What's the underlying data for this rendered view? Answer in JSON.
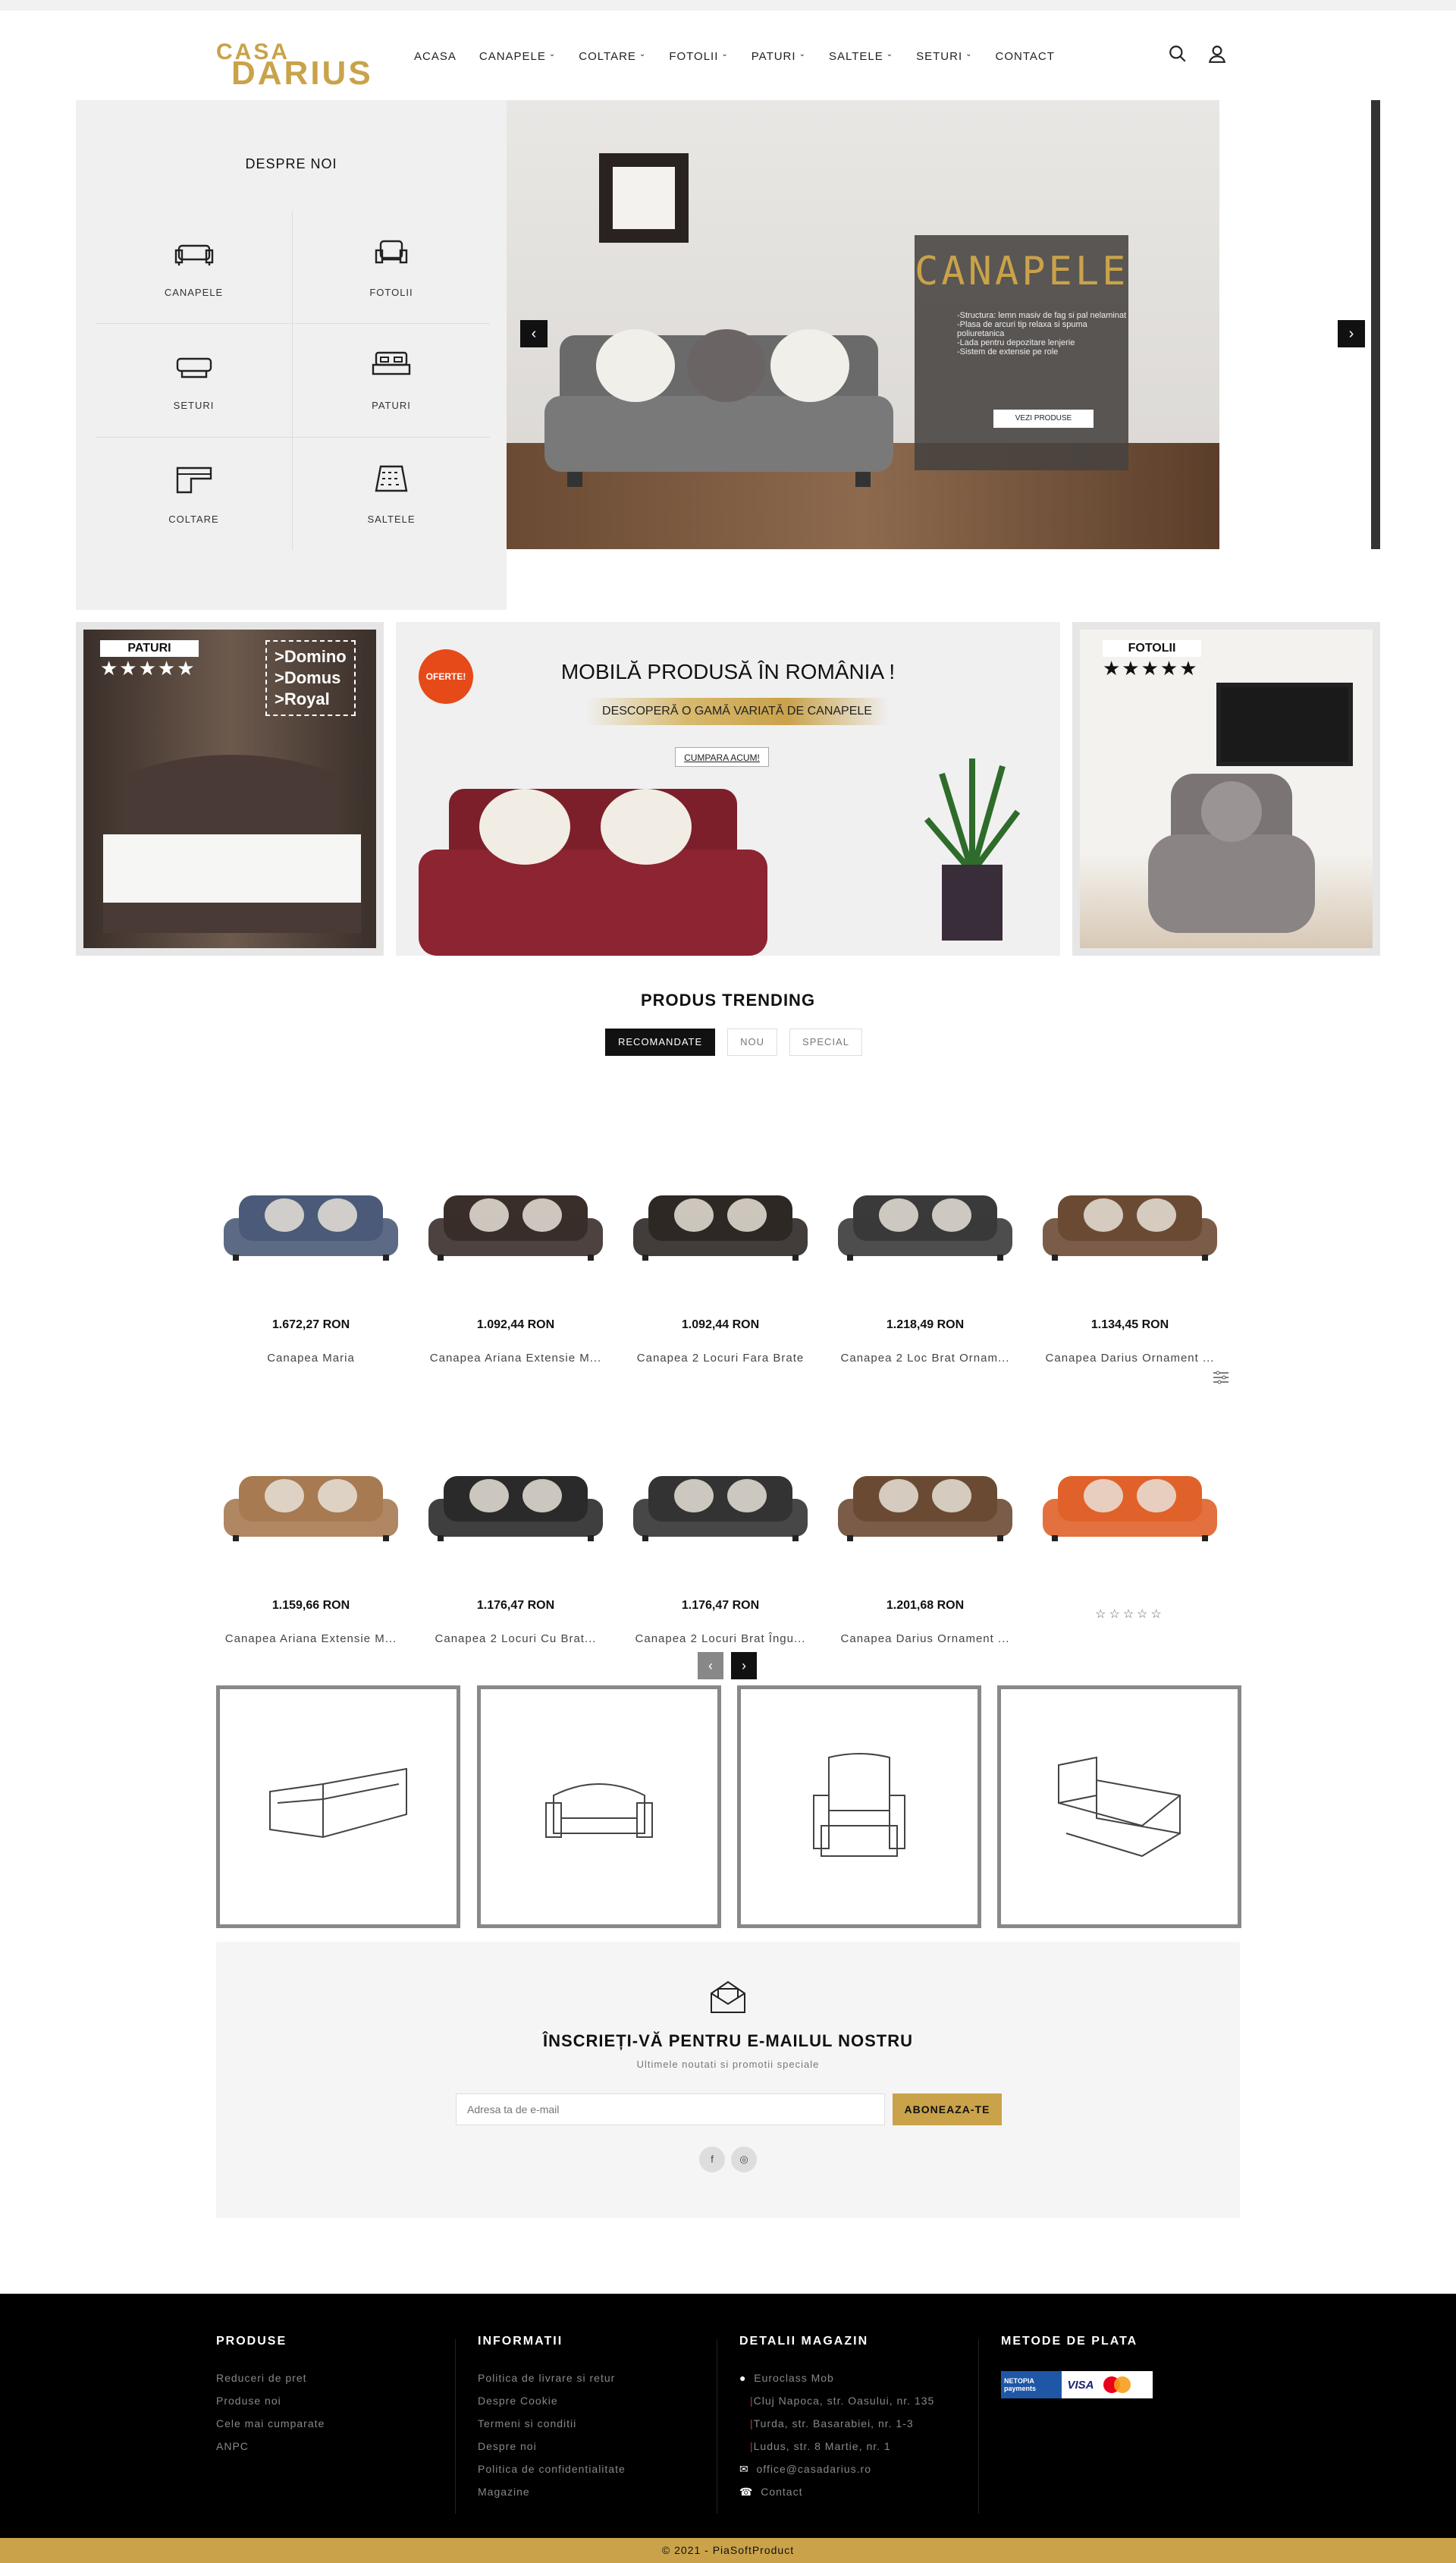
{
  "header": {
    "logo_top": "CASA",
    "logo_bottom": "DARIUS",
    "nav": [
      "ACASA",
      "CANAPELE",
      "COLTARE",
      "FOTOLII",
      "PATURI",
      "SALTELE",
      "SETURI",
      "CONTACT"
    ],
    "nav_dropdown": [
      false,
      true,
      true,
      true,
      true,
      true,
      true,
      false
    ]
  },
  "about": {
    "title": "DESPRE NOI",
    "categories": [
      {
        "label": "CANAPELE",
        "icon": "sofa-icon"
      },
      {
        "label": "FOTOLII",
        "icon": "armchair-icon"
      },
      {
        "label": "SETURI",
        "icon": "sofa-set-icon"
      },
      {
        "label": "PATURI",
        "icon": "bed-icon"
      },
      {
        "label": "COLTARE",
        "icon": "corner-sofa-icon"
      },
      {
        "label": "SALTELE",
        "icon": "mattress-icon"
      }
    ]
  },
  "slider": {
    "title": "CANAPELE",
    "lines": [
      "-Structura: lemn masiv de fag si pal nelaminat",
      "-Plasa de arcuri tip relaxa si spuma poliuretanica",
      "-Lada pentru depozitare lenjerie",
      "-Sistem de extensie pe role"
    ],
    "button": "VEZI PRODUSE"
  },
  "banners": {
    "left_tag": "PATURI",
    "left_list": [
      "Domino",
      "Domus",
      "Royal"
    ],
    "mid_badge": "OFERTE!",
    "mid_title": "MOBILĂ PRODUSĂ ÎN ROMÂNIA !",
    "mid_sub": "DESCOPERĂ O GAMĂ VARIATĂ DE CANAPELE",
    "mid_button": "CUMPARA ACUM!",
    "right_tag": "FOTOLII"
  },
  "trending": {
    "title": "PRODUS TRENDING",
    "tabs": [
      "RECOMANDATE",
      "NOU",
      "SPECIAL"
    ],
    "products": [
      {
        "price": "1.672,27 RON",
        "name": "Canapea Maria",
        "color": "#4a5a78"
      },
      {
        "price": "1.092,44 RON",
        "name": "Canapea Ariana Extensie M...",
        "color": "#3a2e2a"
      },
      {
        "price": "1.092,44 RON",
        "name": "Canapea 2 Locuri Fara Brate",
        "color": "#2e2825"
      },
      {
        "price": "1.218,49 RON",
        "name": "Canapea 2 Loc Brat Ornam...",
        "color": "#3a3a3a"
      },
      {
        "price": "1.134,45 RON",
        "name": "Canapea Darius Ornament ...",
        "color": "#6b4a34"
      },
      {
        "price": "1.159,66 RON",
        "name": "Canapea Ariana Extensie M...",
        "color": "#a77a52"
      },
      {
        "price": "1.176,47 RON",
        "name": "Canapea 2 Locuri Cu Brat...",
        "color": "#2a2a2a"
      },
      {
        "price": "1.176,47 RON",
        "name": "Canapea 2 Locuri Brat Îngu...",
        "color": "#333333"
      },
      {
        "price": "1.201,68 RON",
        "name": "Canapea Darius Ornament ...",
        "color": "#6b4a34"
      },
      {
        "price": "",
        "name": "",
        "color": "#e0622a",
        "stars": "☆☆☆☆☆"
      }
    ]
  },
  "pager": {
    "prev": "‹",
    "next": "›"
  },
  "newsletter": {
    "title": "ÎNSCRIEȚI-VĂ PENTRU E-MAILUL NOSTRU",
    "subtitle": "Ultimele noutati si promotii speciale",
    "placeholder": "Adresa ta de e-mail",
    "button": "ABONEAZA-TE",
    "social": [
      "f",
      "◎"
    ]
  },
  "footer": {
    "produse": {
      "title": "PRODUSE",
      "items": [
        "Reduceri de pret",
        "Produse noi",
        "Cele mai cumparate",
        "ANPC"
      ]
    },
    "informatii": {
      "title": "INFORMATII",
      "items": [
        "Politica de livrare si retur",
        "Despre Cookie",
        "Termeni si conditii",
        "Despre noi",
        "Politica de confidentialitate",
        "Magazine"
      ]
    },
    "magazin": {
      "title": "DETALII MAGAZIN",
      "items": [
        "Euroclass Mob",
        "Cluj Napoca, str. Oasului, nr. 135",
        "Turda, str. Basarabiei, nr. 1-3",
        "Ludus, str. 8 Martie, nr. 1",
        "office@casadarius.ro",
        "Contact"
      ]
    },
    "plata": {
      "title": "METODE DE PLATA",
      "netopia": "NETOPIA payments",
      "visa": "VISA"
    },
    "copyright": "© 2021 - PiaSoftProduct"
  },
  "colors": {
    "accent": "#c9a24a",
    "footer_bg": "#000000"
  }
}
